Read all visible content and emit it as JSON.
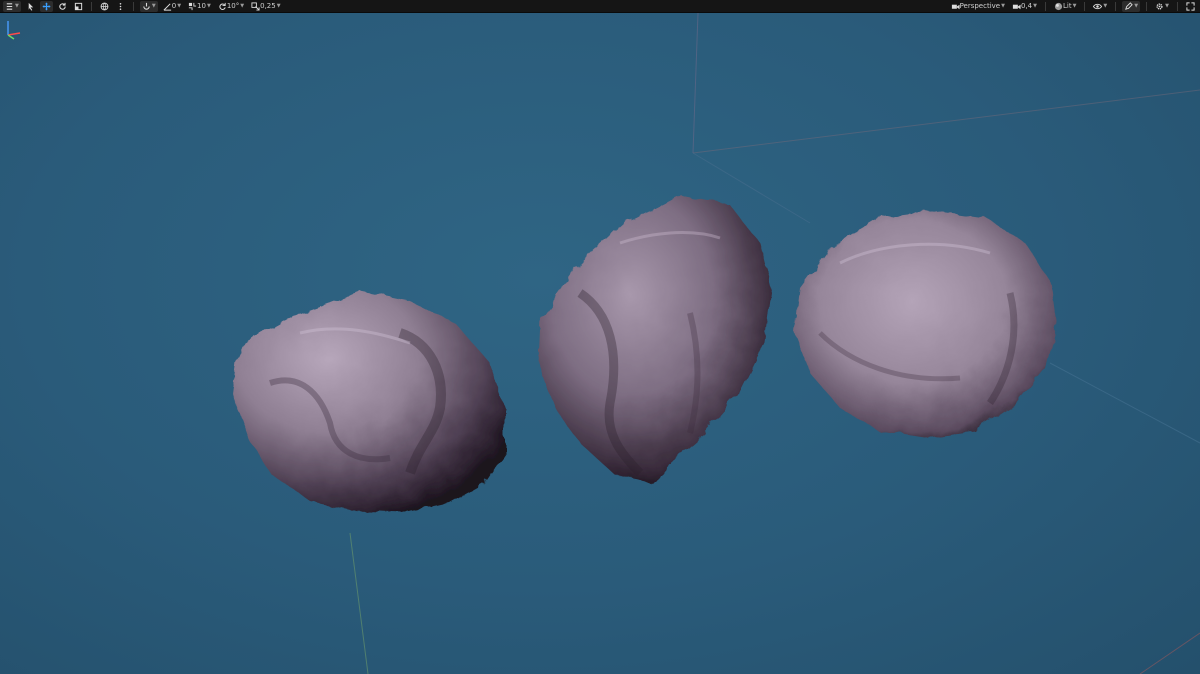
{
  "toolbar": {
    "left": {
      "snap_angle": "0",
      "grid_size": "10",
      "rotation_snap": "10°",
      "scale_snap": "0,25"
    },
    "right": {
      "view_mode": "Perspective",
      "camera_speed": "0,4",
      "lighting_mode": "Lit"
    }
  },
  "colors": {
    "viewport_bg": "#2a5a7a",
    "rock_base": "#8f7f93",
    "rock_shadow": "#2a1f2c",
    "toolbar_bg": "#151515"
  },
  "scene": {
    "objects": [
      "rock-mesh-1",
      "rock-mesh-2",
      "rock-mesh-3"
    ]
  }
}
